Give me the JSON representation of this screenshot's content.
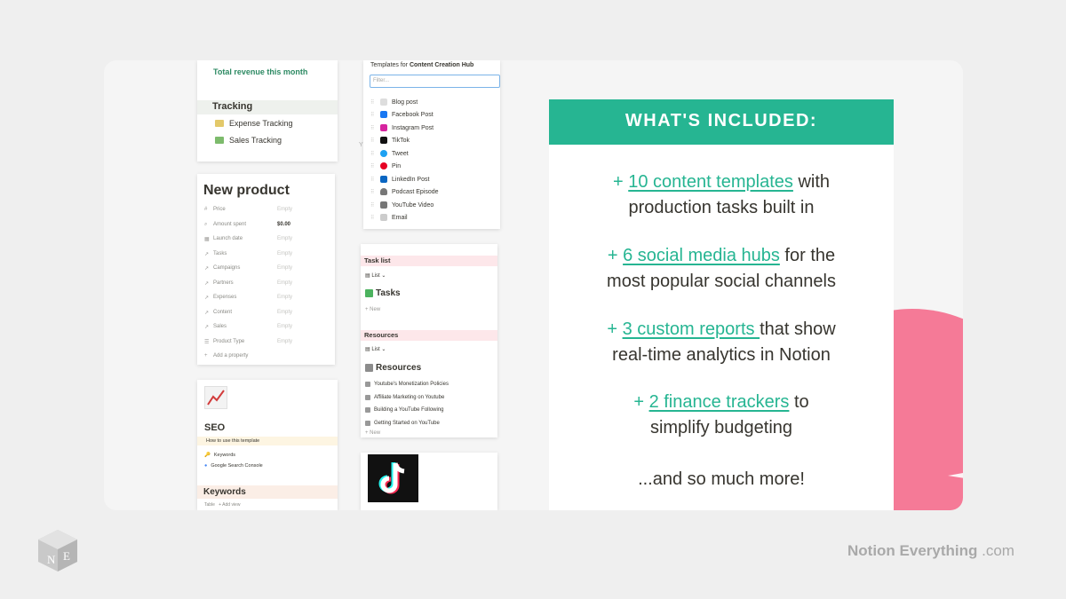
{
  "finance_panel": {
    "revenue_label": "Total revenue this month",
    "tracking_heading": "Tracking",
    "items": [
      {
        "label": "Expense Tracking",
        "icon": "money-icon"
      },
      {
        "label": "Sales Tracking",
        "icon": "cash-icon"
      }
    ]
  },
  "product_panel": {
    "title": "New product",
    "properties": [
      {
        "name": "Price",
        "value": "Empty",
        "icon": "hash-icon"
      },
      {
        "name": "Amount spent",
        "value": "$0.00",
        "icon": "search-icon"
      },
      {
        "name": "Launch date",
        "value": "Empty",
        "icon": "calendar-icon"
      },
      {
        "name": "Tasks",
        "value": "Empty",
        "icon": "relation-icon"
      },
      {
        "name": "Campaigns",
        "value": "Empty",
        "icon": "relation-icon"
      },
      {
        "name": "Partners",
        "value": "Empty",
        "icon": "relation-icon"
      },
      {
        "name": "Expenses",
        "value": "Empty",
        "icon": "relation-icon"
      },
      {
        "name": "Content",
        "value": "Empty",
        "icon": "relation-icon"
      },
      {
        "name": "Sales",
        "value": "Empty",
        "icon": "relation-icon"
      },
      {
        "name": "Product Type",
        "value": "Empty",
        "icon": "list-icon"
      }
    ],
    "add_property": "Add a property"
  },
  "seo_panel": {
    "title": "SEO",
    "howto": "How to use this template",
    "links": [
      "Keywords",
      "Google Search Console"
    ],
    "keywords_heading": "Keywords",
    "table_label": "Table",
    "add_view": "+ Add view"
  },
  "templates_panel": {
    "header_prefix": "Templates for ",
    "header_bold": "Content Creation Hub",
    "filter_placeholder": "Filter...",
    "items": [
      {
        "label": "Blog post",
        "color": "#9b9a97"
      },
      {
        "label": "Facebook Post",
        "color": "#1877f2"
      },
      {
        "label": "Instagram Post",
        "color": "#d6249f"
      },
      {
        "label": "TikTok",
        "color": "#111111"
      },
      {
        "label": "Tweet",
        "color": "#1da1f2"
      },
      {
        "label": "Pin",
        "color": "#e60023"
      },
      {
        "label": "LinkedIn Post",
        "color": "#0a66c2"
      },
      {
        "label": "Podcast Episode",
        "color": "#555555"
      },
      {
        "label": "YouTube Video",
        "color": "#555555"
      },
      {
        "label": "Email",
        "color": "#9b9a97"
      }
    ]
  },
  "tasks_panel": {
    "task_bar": "Task list",
    "view_label": "List",
    "tasks_heading": "Tasks",
    "new_label": "+ New",
    "resources_bar": "Resources",
    "resources_heading": "Resources",
    "resources": [
      "Youtube's Monetization Policies",
      "Affiliate Marketing on Youtube",
      "Building a YouTube Following",
      "Getting Started on YouTube"
    ]
  },
  "stray_char": "Y",
  "included": {
    "heading": "WHAT'S INCLUDED:",
    "items": [
      {
        "plus": "+ ",
        "highlight": "10 content templates",
        "rest1": " with",
        "rest2": "production tasks built in"
      },
      {
        "plus": "+ ",
        "highlight": "6 social media hubs",
        "rest1": " for the",
        "rest2": "most popular social channels"
      },
      {
        "plus": "+ ",
        "highlight": "3 custom reports ",
        "rest1": "that show",
        "rest2": "real-time analytics in Notion"
      },
      {
        "plus": "+ ",
        "highlight": "2 finance trackers",
        "rest1": " to",
        "rest2": "simplify budgeting"
      }
    ],
    "more": "...and so much more!"
  },
  "brand": {
    "name": "Notion Everything",
    "domain": " .com",
    "logo_letters": [
      "N",
      "E"
    ]
  },
  "colors": {
    "accent": "#26b592",
    "pink": "#f57a97",
    "background": "#efefef"
  }
}
